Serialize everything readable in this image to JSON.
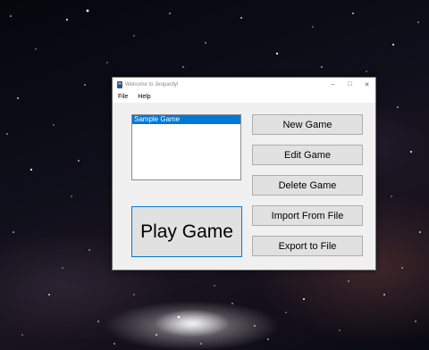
{
  "window": {
    "title": "Welcome to Jeopardy!",
    "controls": {
      "minimize": "–",
      "maximize": "□",
      "close": "✕"
    }
  },
  "menu": [
    "File",
    "Help"
  ],
  "game_list": {
    "items": [
      {
        "label": "Sample Game",
        "selected": true
      }
    ]
  },
  "buttons": {
    "new_game": "New Game",
    "edit_game": "Edit Game",
    "delete_game": "Delete Game",
    "import_from_file": "Import From File",
    "export_to_file": "Export to File",
    "play_game": "Play Game"
  },
  "colors": {
    "selection": "#0078d7",
    "button_face": "#e1e1e1",
    "window_bg": "#f0f0f0"
  }
}
